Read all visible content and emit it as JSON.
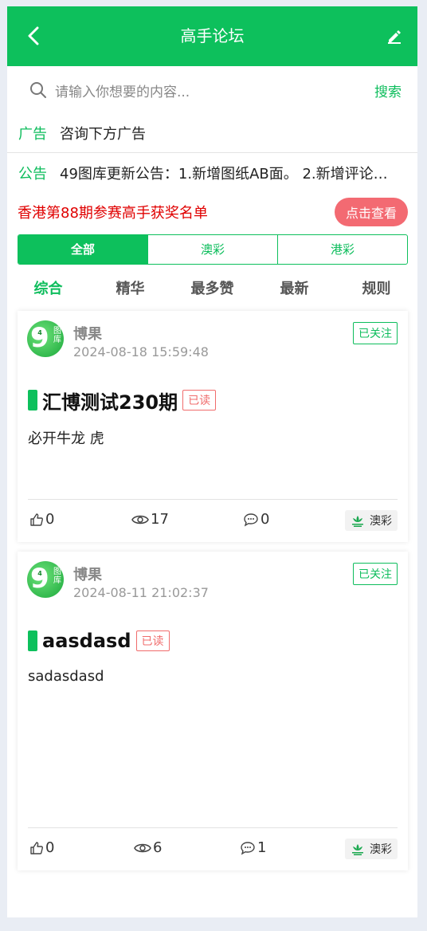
{
  "header": {
    "title": "高手论坛"
  },
  "search": {
    "placeholder": "请输入你想要的内容...",
    "button": "搜索"
  },
  "ad": {
    "tag": "广告",
    "text": "咨询下方广告"
  },
  "announcement": {
    "tag": "公告",
    "text": "49图库更新公告：1.新增图纸AB面。 2.新增评论…"
  },
  "award": {
    "text": "香港第88期参赛高手获奖名单",
    "button": "点击查看"
  },
  "segments": [
    "全部",
    "澳彩",
    "港彩"
  ],
  "tabs": [
    "综合",
    "精华",
    "最多赞",
    "最新",
    "规则"
  ],
  "posts": [
    {
      "user": "博果",
      "time": "2024-08-18 15:59:48",
      "follow": "已关注",
      "title": "汇博测试230期",
      "read": "已读",
      "body": "必开牛龙 虎",
      "likes": "0",
      "views": "17",
      "comments": "0",
      "region": "澳彩"
    },
    {
      "user": "博果",
      "time": "2024-08-11 21:02:37",
      "follow": "已关注",
      "title": "aasdasd",
      "read": "已读",
      "body": "sadasdasd",
      "likes": "0",
      "views": "6",
      "comments": "1",
      "region": "澳彩"
    }
  ],
  "colors": {
    "primary": "#0dc05c",
    "alert": "#e00000",
    "button_pink": "#f36a72"
  }
}
